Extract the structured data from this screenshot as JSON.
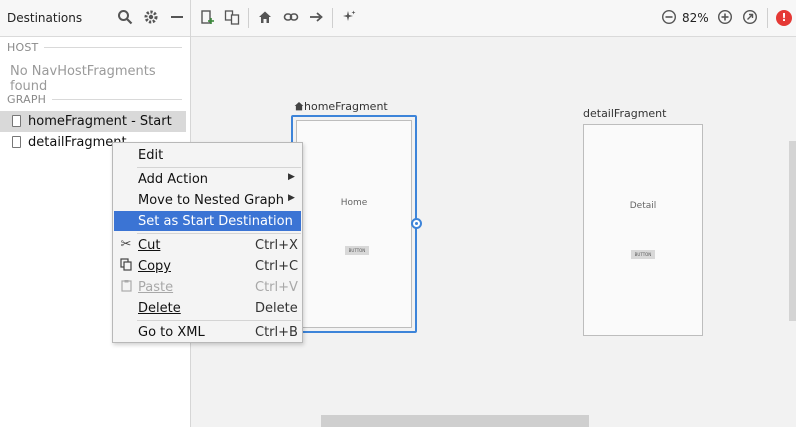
{
  "left_panel": {
    "title": "Destinations",
    "host_label": "HOST",
    "host_empty": "No NavHostFragments found",
    "graph_label": "GRAPH",
    "items": [
      {
        "label": "homeFragment - Start",
        "selected": true
      },
      {
        "label": "detailFragment",
        "selected": false
      }
    ],
    "header_icons": [
      "search-icon",
      "gear-icon",
      "collapse-icon"
    ]
  },
  "toolbar": {
    "icons": [
      "new-destination-icon",
      "nested-graph-icon",
      "home-icon",
      "link-icon",
      "action-arrow-icon",
      "auto-arrange-icon"
    ],
    "zoom": "82%",
    "zoom_out_icon": "zoom-out-icon",
    "zoom_in_icon": "zoom-in-icon",
    "zoom_fit_icon": "zoom-fit-icon",
    "error_icon": "error-icon",
    "error_text": "!"
  },
  "canvas": {
    "home_fragment": {
      "label": "homeFragment",
      "screen_text": "Home",
      "button_text": "BUTTON"
    },
    "detail_fragment": {
      "label": "detailFragment",
      "screen_text": "Detail",
      "button_text": "BUTTON"
    }
  },
  "context_menu": {
    "items": [
      {
        "label": "Edit",
        "shortcut": "",
        "submenu": false
      },
      {
        "label": "Add Action",
        "shortcut": "",
        "submenu": true
      },
      {
        "label": "Move to Nested Graph",
        "shortcut": "",
        "submenu": true
      },
      {
        "label": "Set as Start Destination",
        "shortcut": "",
        "submenu": false,
        "highlighted": true
      },
      {
        "label": "Cut",
        "shortcut": "Ctrl+X",
        "icon": "scissors-icon"
      },
      {
        "label": "Copy",
        "shortcut": "Ctrl+C",
        "icon": "copy-icon"
      },
      {
        "label": "Paste",
        "shortcut": "Ctrl+V",
        "icon": "clipboard-icon",
        "disabled": true
      },
      {
        "label": "Delete",
        "shortcut": "Delete"
      },
      {
        "label": "Go to XML",
        "shortcut": "Ctrl+B"
      }
    ]
  },
  "colors": {
    "selection_blue": "#3b74d4",
    "frame_blue": "#3d84d9",
    "error_red": "#e53935"
  }
}
